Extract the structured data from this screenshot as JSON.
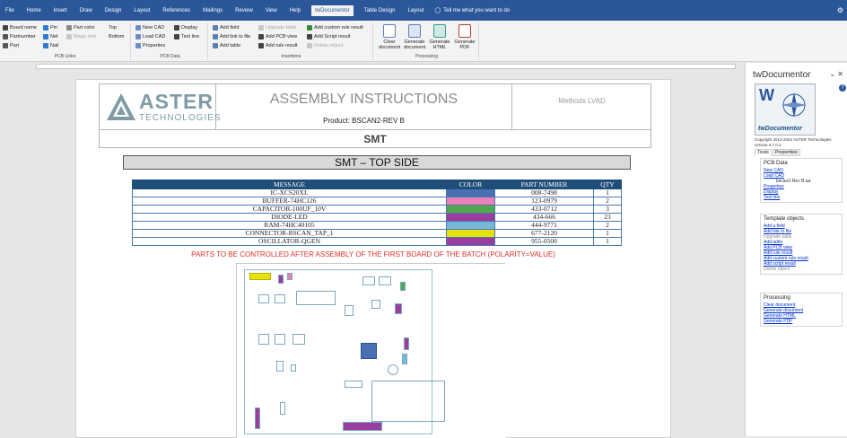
{
  "ribbon_tabs": [
    "File",
    "Home",
    "Insert",
    "Draw",
    "Design",
    "Layout",
    "References",
    "Mailings",
    "Review",
    "View",
    "Help",
    "twDocumentor",
    "Table Design",
    "Layout"
  ],
  "tell_me": "Tell me what you want to do",
  "ribbon": {
    "pcb_links": {
      "label": "PCB Links",
      "items": [
        "Board name",
        "Pin",
        "Part color",
        "Top",
        "Partnumber",
        "Net",
        "Magic text",
        "Bottom",
        "Part",
        "Nail"
      ]
    },
    "pcb_data": {
      "label": "PCB Data",
      "items": [
        "New CAD",
        "Display",
        "Load CAD",
        "Test line",
        "Properties"
      ]
    },
    "insertions": {
      "label": "Insertions",
      "items": [
        "Add field",
        "Upgrade table",
        "Add custom rule result",
        "Add link to file",
        "Add PCB view",
        "Add Script result",
        "Add table",
        "Add rule result",
        "Delete object"
      ]
    },
    "processing": {
      "label": "Processing",
      "buttons": [
        "Clear document",
        "Generate document",
        "Generate HTML",
        "Generate PDF"
      ]
    }
  },
  "header": {
    "logo_name": "ASTER",
    "logo_sub": "TECHNOLOGIES",
    "title": "ASSEMBLY INSTRUCTIONS",
    "product": "Product: BSCAN2-REV B",
    "methods": "Methods LVAD"
  },
  "section_title": "SMT",
  "subsection_title": "SMT – TOP SIDE",
  "table": {
    "headers": [
      "MESSAGE",
      "COLOR",
      "PART NUMBER",
      "QTY"
    ],
    "rows": [
      {
        "message": "IC-XCS20XL",
        "color": "#4a6fb5",
        "part": "008-7498",
        "qty": "1"
      },
      {
        "message": "BUFFER-74HC126",
        "color": "#ea7fb9",
        "part": "123-0979",
        "qty": "2"
      },
      {
        "message": "CAPACITOR-100UF_10V",
        "color": "#4fa84f",
        "part": "433-0712",
        "qty": "3"
      },
      {
        "message": "DIODE-LED",
        "color": "#9a3d9e",
        "part": "434-666",
        "qty": "23"
      },
      {
        "message": "RAM-74HC40105",
        "color": "#77b8d8",
        "part": "444-9771",
        "qty": "2"
      },
      {
        "message": "CONNECTOR-BSCAN_TAP_1",
        "color": "#e6e20f",
        "part": "677-2120",
        "qty": "1"
      },
      {
        "message": "OSCILLATOR-QGEN",
        "color": "#9a3d9e",
        "part": "955-0500",
        "qty": "1"
      }
    ]
  },
  "warning": "PARTS TO BE CONTROLLED AFTER ASSEMBLY OF THE FIRST BOARD OF THE BATCH (POLARITY=VALUE)",
  "pane": {
    "title": "twDocumentor",
    "logo_text": "twDocumentor",
    "copyright": "Copyright 2012-2022 ASTER Technologies",
    "version": "version 4.7.0.2",
    "tabs": [
      "Tools",
      "Properties"
    ],
    "pcb_data": {
      "title": "PCB Data",
      "links": [
        "New CAD",
        "Load CAD"
      ],
      "cad_name": "bscan2-Rev B.aa",
      "links2": [
        "Properties",
        "Display",
        "Test line"
      ]
    },
    "template": {
      "title": "Template objects",
      "links": [
        "Add a field",
        "Add link to file"
      ],
      "disabled": "Upgrade table",
      "links2": [
        "Add table",
        "Add PCB view",
        "Add rule result",
        "Add custom rule result",
        "Add script result"
      ],
      "disabled2": "Delete object"
    },
    "processing": {
      "title": "Processing",
      "links": [
        "Clear document",
        "Generate document",
        "Generate HTML",
        "Generate PDF"
      ]
    }
  },
  "colors": {
    "ribbon": "#2b579a",
    "table_header": "#1f4e79",
    "warning": "#e0302a",
    "link": "#0033cc"
  }
}
